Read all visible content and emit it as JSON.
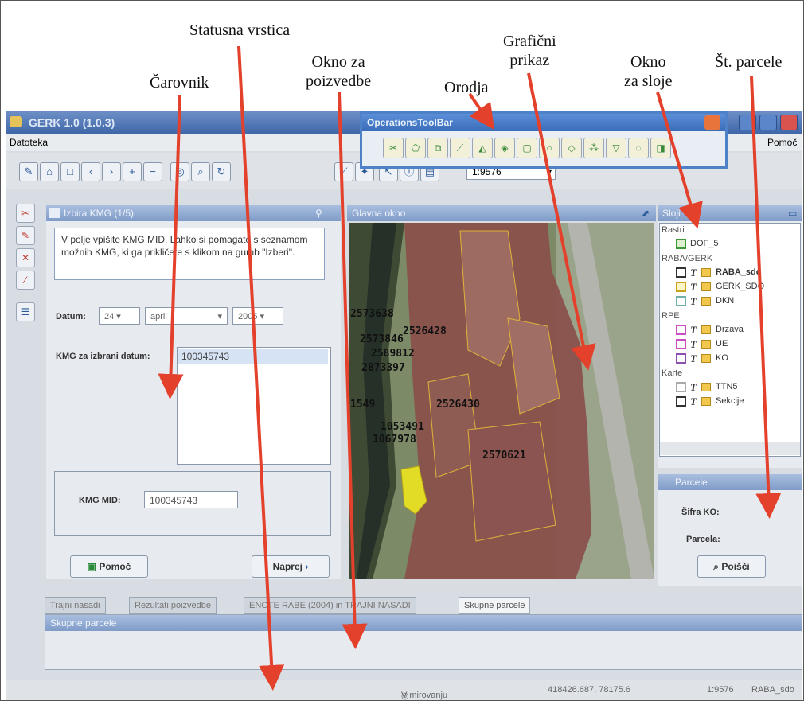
{
  "annotations": {
    "statusna_vrstica": "Statusna vrstica",
    "graficni_prikaz": [
      "Grafični",
      "prikaz"
    ],
    "okno_za_poizvedbe": [
      "Okno za",
      "poizvedbe"
    ],
    "carovnik": "Čarovnik",
    "orodja": "Orodja",
    "okno_za_sloje": [
      "Okno",
      "za sloje"
    ],
    "st_parcele": "Št. parcele"
  },
  "app": {
    "title": "GERK 1.0 (1.0.3)",
    "menu": {
      "file": "Datoteka",
      "help": "Pomoč"
    },
    "scale_value": "1:9576"
  },
  "ops_toolbar": {
    "title": "OperationsToolBar"
  },
  "wizard": {
    "title": "Izbira KMG (1/5)",
    "info_text": "V polje vpišite KMG MID. Lahko si pomagate s seznamom možnih KMG, ki ga prikličete s klikom na gumb \"Izberi\".",
    "datum_label": "Datum:",
    "day": "24",
    "month": "april",
    "year": "2005",
    "kmg_list_label": "KMG za izbrani datum:",
    "kmg_list": [
      "100345743"
    ],
    "mid_label": "KMG MID:",
    "mid_value": "100345743",
    "help_button": "Pomoč",
    "next_button": "Naprej"
  },
  "map": {
    "title": "Glavna okno",
    "parcels": [
      "2573638",
      "2526428",
      "2573846",
      "2589812",
      "2873397",
      "1549",
      "2526430",
      "1053491",
      "1067978",
      "2570621"
    ]
  },
  "layers": {
    "title": "Sloji",
    "groups": [
      {
        "name": "Rastri",
        "items": [
          {
            "label": "DOF_5",
            "checked": true
          }
        ]
      },
      {
        "name": "RABA/GERK",
        "items": [
          {
            "label": "RABA_sdo",
            "checked": false
          },
          {
            "label": "GERK_SDO",
            "checked": true
          },
          {
            "label": "DKN",
            "checked": false
          }
        ]
      },
      {
        "name": "RPE",
        "items": [
          {
            "label": "Drzava",
            "checked": false
          },
          {
            "label": "UE",
            "checked": false
          },
          {
            "label": "KO",
            "checked": false
          }
        ]
      },
      {
        "name": "Karte",
        "items": [
          {
            "label": "TTN5",
            "checked": false
          },
          {
            "label": "Sekcije",
            "checked": false
          }
        ]
      }
    ]
  },
  "parcele": {
    "title": "Parcele",
    "sifra_label": "Šifra KO:",
    "parcela_label": "Parcela:",
    "search_button": "Poišči"
  },
  "tabs": [
    "Trajni nasadi",
    "Rezultati poizvedbe",
    "ENOTE RABE (2004) in TRAJNI NASADI",
    "Skupne parcele"
  ],
  "bottom_panel": {
    "title": "Skupne parcele"
  },
  "status": {
    "state": "V mirovanju",
    "coords": "418426.687, 78175.6",
    "scale": "1:9576",
    "layer": "RABA_sdo"
  },
  "colors": {
    "arrow": "#e3412c",
    "accent": "#4d82c9"
  }
}
